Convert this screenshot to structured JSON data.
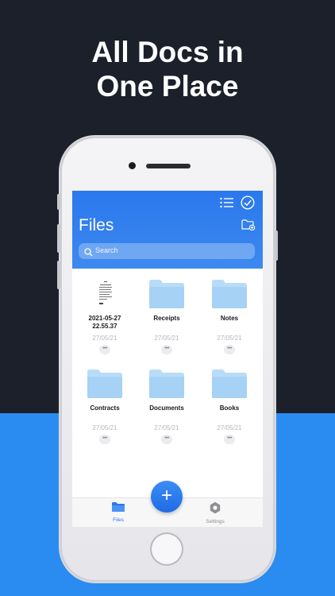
{
  "promo": {
    "headline_line1": "All Docs in",
    "headline_line2": "One Place"
  },
  "app": {
    "title": "Files",
    "search": {
      "placeholder": "Search"
    },
    "items": [
      {
        "name_line1": "2021-05-27",
        "name_line2": "22.55.37",
        "date": "27/05/21",
        "kind": "document-thumbnail"
      },
      {
        "name_line1": "Receipts",
        "name_line2": "",
        "date": "27/05/21",
        "kind": "folder"
      },
      {
        "name_line1": "Notes",
        "name_line2": "",
        "date": "27/05/21",
        "kind": "folder"
      },
      {
        "name_line1": "Contracts",
        "name_line2": "",
        "date": "27/05/21",
        "kind": "folder"
      },
      {
        "name_line1": "Documents",
        "name_line2": "",
        "date": "27/05/21",
        "kind": "folder"
      },
      {
        "name_line1": "Books",
        "name_line2": "",
        "date": "27/05/21",
        "kind": "folder"
      }
    ],
    "more_label": "•••",
    "fab_label": "+",
    "tabs": [
      {
        "label": "Files",
        "icon": "folder-icon",
        "active": true
      },
      {
        "label": "Settings",
        "icon": "gear-icon",
        "active": false
      }
    ],
    "colors": {
      "accent": "#2a78ee",
      "folder": "#a9d4f6",
      "inactive": "#8e8e93"
    }
  }
}
